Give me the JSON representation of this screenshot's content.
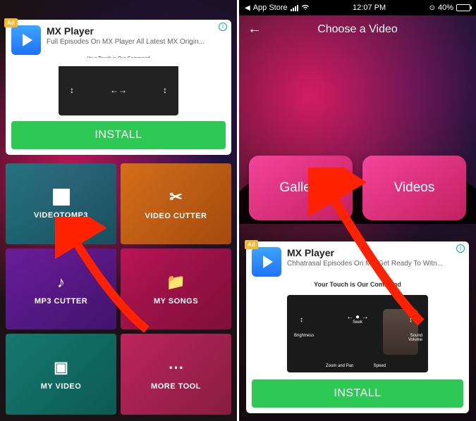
{
  "status_bar": {
    "carrier": "App Store",
    "time": "12:07 PM",
    "battery_pct": "40%"
  },
  "screen1": {
    "ad": {
      "title": "MX Player",
      "subtitle": "Full Episodes On MX Player All Latest MX Origin...",
      "preview_caption": "Your Touch is Our Command",
      "install": "INSTALL"
    },
    "tiles": {
      "video_to_mp3": "VIDEOTOMP3",
      "video_cutter": "VIDEO CUTTER",
      "mp3_cutter": "MP3 CUTTER",
      "my_songs": "MY SONGS",
      "my_video": "MY VIDEO",
      "more_tool": "MORE TOOL"
    }
  },
  "screen2": {
    "header_title": "Choose a Video",
    "buttons": {
      "gallery": "Gallery",
      "videos": "Videos"
    },
    "ad": {
      "title": "MX Player",
      "subtitle": "Chhatrasal Episodes On MX Get Ready To Witn...",
      "preview_caption": "Your Touch is Our Command",
      "gesture_labels": {
        "seek": "Seek",
        "brightness": "Brightness",
        "volume": "Sound Volume",
        "zoom": "Zoom and Pan",
        "speed": "Speed"
      },
      "install": "INSTALL"
    }
  }
}
